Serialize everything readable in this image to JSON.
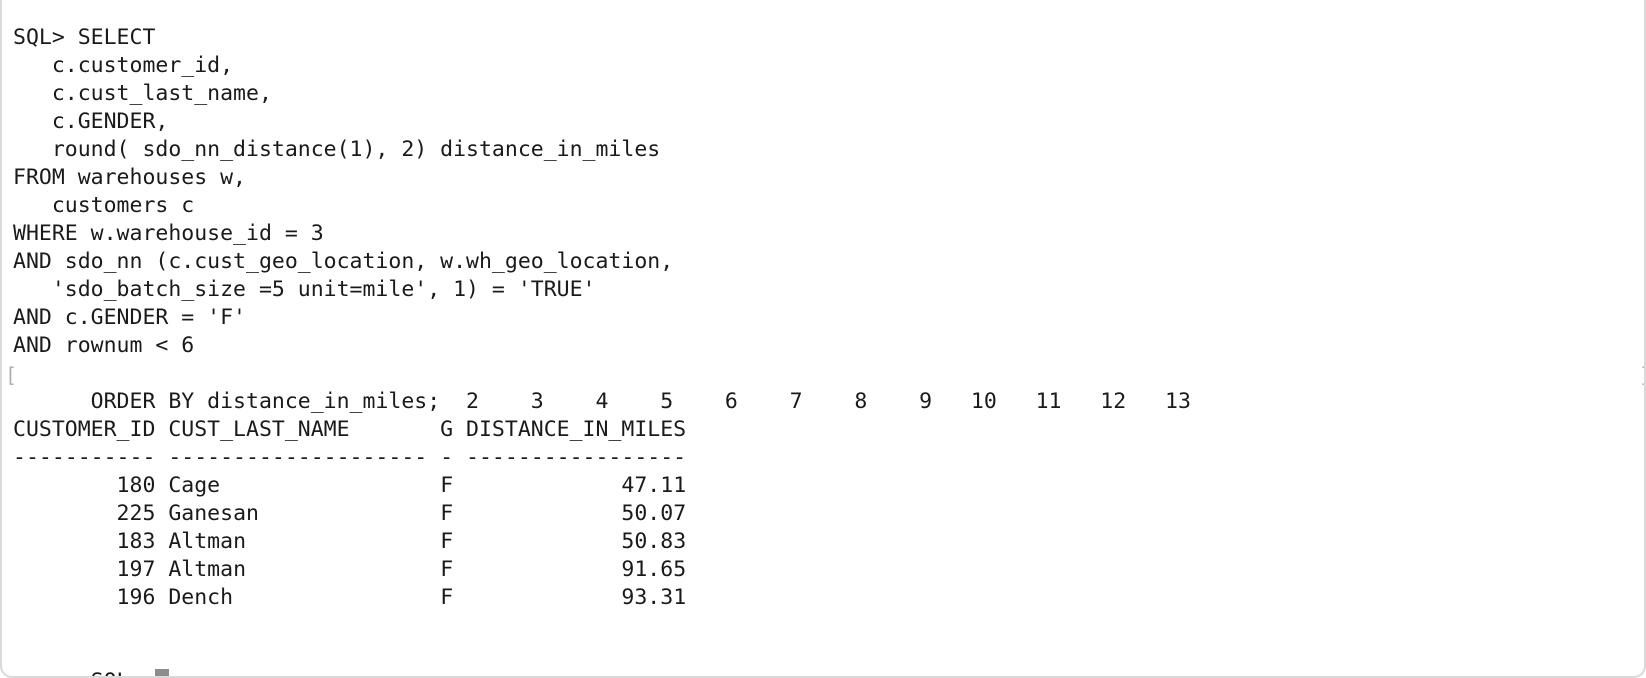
{
  "terminal": {
    "query_lines": [
      "SQL> SELECT",
      "   c.customer_id,",
      "   c.cust_last_name,",
      "   c.GENDER,",
      "   round( sdo_nn_distance(1), 2) distance_in_miles",
      "FROM warehouses w,",
      "   customers c",
      "WHERE w.warehouse_id = 3",
      "AND sdo_nn (c.cust_geo_location, w.wh_geo_location,",
      "   'sdo_batch_size =5 unit=mile', 1) = 'TRUE'",
      "AND c.GENDER = 'F'",
      "AND rownum < 6"
    ],
    "last_query_line": "ORDER BY distance_in_miles;  2    3    4    5    6    7    8    9   10   11   12   13",
    "mark_left": "[",
    "mark_right": "]",
    "result": {
      "header": "CUSTOMER_ID CUST_LAST_NAME       G DISTANCE_IN_MILES",
      "separator": "----------- -------------------- - -----------------",
      "rows": [
        {
          "customer_id": "180",
          "cust_last_name": "Cage",
          "gender": "F",
          "distance_in_miles": "47.11"
        },
        {
          "customer_id": "225",
          "cust_last_name": "Ganesan",
          "gender": "F",
          "distance_in_miles": "50.07"
        },
        {
          "customer_id": "183",
          "cust_last_name": "Altman",
          "gender": "F",
          "distance_in_miles": "50.83"
        },
        {
          "customer_id": "197",
          "cust_last_name": "Altman",
          "gender": "F",
          "distance_in_miles": "91.65"
        },
        {
          "customer_id": "196",
          "cust_last_name": "Dench",
          "gender": "F",
          "distance_in_miles": "93.31"
        }
      ]
    },
    "prompt": "SQL> "
  }
}
